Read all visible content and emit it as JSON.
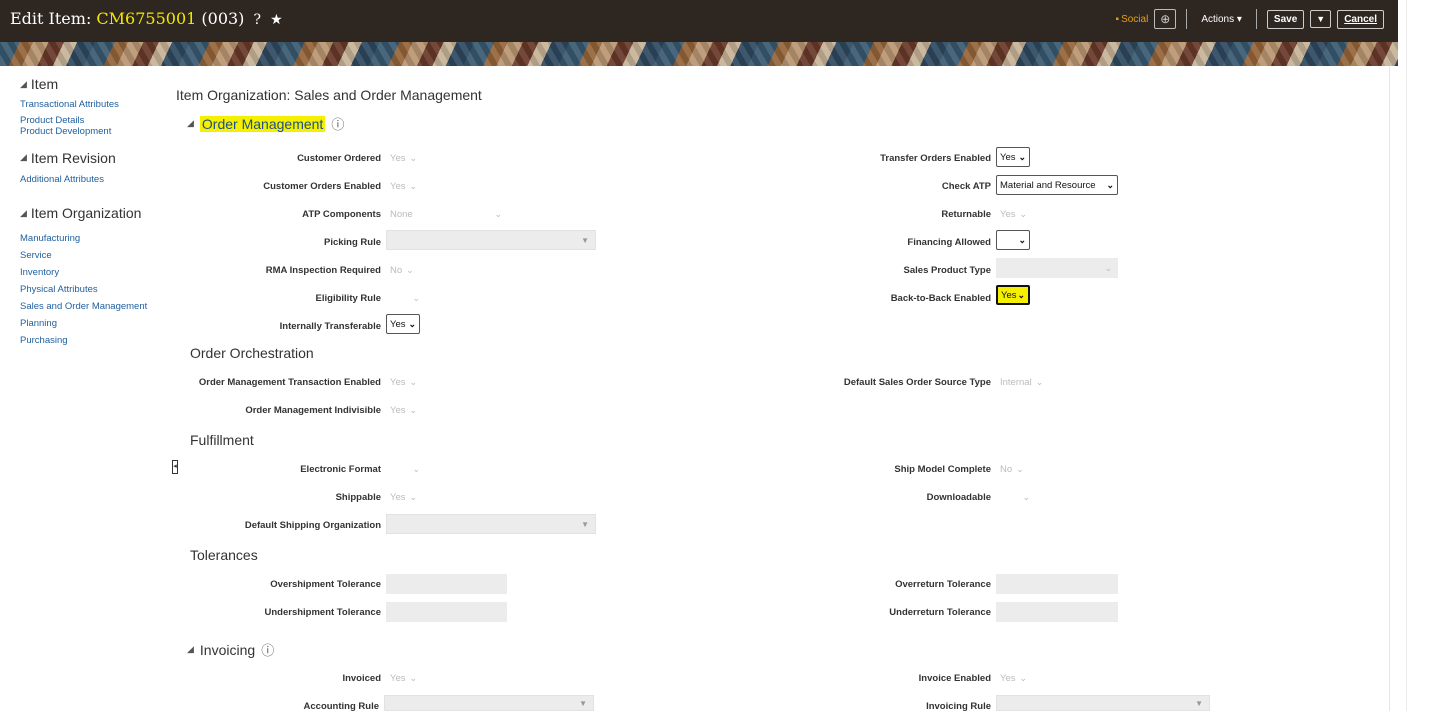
{
  "header": {
    "title_prefix": "Edit Item: ",
    "item_number": "CM6755001",
    "item_suffix": " (003)",
    "help_glyph": "?",
    "favorite_glyph": "★",
    "social_label": "Social",
    "actions_label": "Actions",
    "save_label": "Save",
    "cancel_label": "Cancel"
  },
  "sidebar": {
    "groups": [
      {
        "title": "Item",
        "links": [
          "Transactional Attributes",
          "Product Details",
          "Product Development"
        ]
      },
      {
        "title": "Item Revision",
        "links": [
          "Additional Attributes"
        ]
      },
      {
        "title": "Item Organization",
        "links": [
          "Manufacturing",
          "Service",
          "Inventory",
          "Physical Attributes",
          "Sales and Order Management",
          "Planning",
          "Purchasing"
        ]
      }
    ]
  },
  "page": {
    "heading": "Item Organization: Sales and Order Management",
    "sections": {
      "order_management": "Order Management",
      "order_orchestration": "Order Orchestration",
      "fulfillment": "Fulfillment",
      "tolerances": "Tolerances",
      "invoicing": "Invoicing"
    }
  },
  "fields": {
    "customer_ordered": {
      "label": "Customer Ordered",
      "value": "Yes"
    },
    "customer_orders_enabled": {
      "label": "Customer Orders Enabled",
      "value": "Yes"
    },
    "atp_components": {
      "label": "ATP Components",
      "value": "None"
    },
    "picking_rule": {
      "label": "Picking Rule",
      "value": ""
    },
    "rma_inspection_required": {
      "label": "RMA Inspection Required",
      "value": "No"
    },
    "eligibility_rule": {
      "label": "Eligibility Rule",
      "value": ""
    },
    "internally_transferable": {
      "label": "Internally Transferable",
      "value": "Yes"
    },
    "transfer_orders_enabled": {
      "label": "Transfer Orders Enabled",
      "value": "Yes"
    },
    "check_atp": {
      "label": "Check ATP",
      "value": "Material and Resource"
    },
    "returnable": {
      "label": "Returnable",
      "value": "Yes"
    },
    "financing_allowed": {
      "label": "Financing Allowed",
      "value": ""
    },
    "sales_product_type": {
      "label": "Sales Product Type",
      "value": ""
    },
    "back_to_back_enabled": {
      "label": "Back-to-Back Enabled",
      "value": "Yes"
    },
    "om_transaction_enabled": {
      "label": "Order Management Transaction Enabled",
      "value": "Yes"
    },
    "om_indivisible": {
      "label": "Order Management Indivisible",
      "value": "Yes"
    },
    "default_so_source_type": {
      "label": "Default Sales Order Source Type",
      "value": "Internal"
    },
    "electronic_format": {
      "label": "Electronic Format",
      "value": ""
    },
    "shippable": {
      "label": "Shippable",
      "value": "Yes"
    },
    "default_shipping_org": {
      "label": "Default Shipping Organization",
      "value": ""
    },
    "ship_model_complete": {
      "label": "Ship Model Complete",
      "value": "No"
    },
    "downloadable": {
      "label": "Downloadable",
      "value": ""
    },
    "overshipment_tolerance": {
      "label": "Overshipment Tolerance",
      "value": ""
    },
    "undershipment_tolerance": {
      "label": "Undershipment Tolerance",
      "value": ""
    },
    "overreturn_tolerance": {
      "label": "Overreturn Tolerance",
      "value": ""
    },
    "underreturn_tolerance": {
      "label": "Underreturn Tolerance",
      "value": ""
    },
    "invoiced": {
      "label": "Invoiced",
      "value": "Yes"
    },
    "accounting_rule": {
      "label": "Accounting Rule",
      "value": ""
    },
    "invoice_enabled": {
      "label": "Invoice Enabled",
      "value": "Yes"
    },
    "invoicing_rule": {
      "label": "Invoicing Rule",
      "value": ""
    }
  },
  "colors": {
    "header_bg": "#2e2621",
    "highlight": "#f5f000",
    "link": "#1f5f9e"
  }
}
